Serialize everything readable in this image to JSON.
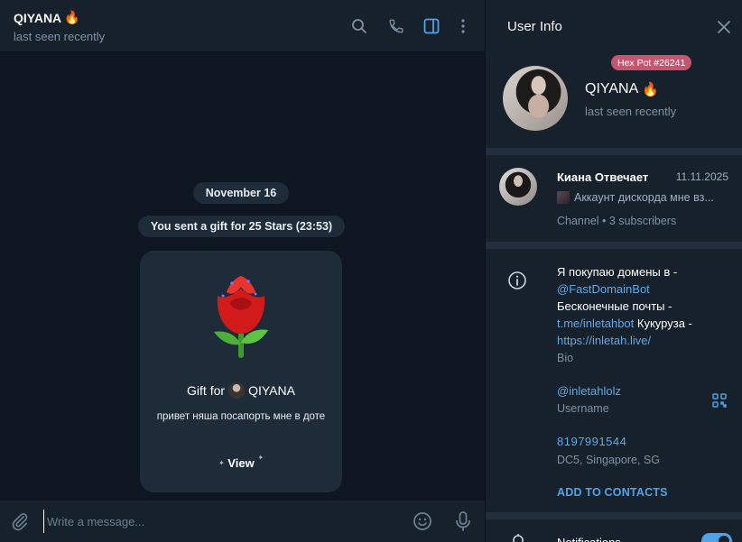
{
  "chat": {
    "title": "QIYANA",
    "title_emoji": "🔥",
    "status": "last seen recently",
    "icons": [
      "search-icon",
      "phone-icon",
      "sidebar-toggle-icon",
      "more-icon"
    ],
    "date_pill": "November 16",
    "service_message": "You sent a gift for 25 Stars (23:53)",
    "gift": {
      "emoji": "🌹",
      "title_prefix": "Gift for",
      "recipient": "QIYANA",
      "message": "привет няша посапорть мне в доте",
      "view_label": "View"
    },
    "composer": {
      "placeholder": "Write a message...",
      "icons": [
        "attach-icon",
        "emoji-icon",
        "microphone-icon"
      ]
    }
  },
  "user_info": {
    "title": "User Info",
    "badge": "Hex Pot #26241",
    "name": "QIYANA",
    "name_emoji": "🔥",
    "status": "last seen recently",
    "channel": {
      "name": "Киана Отвечает",
      "date": "11.11.2025",
      "last_message": "Аккаунт дискорда мне вз...",
      "subscribers": "Channel • 3 subscribers"
    },
    "bio": {
      "line1": "Я покупаю домены в -",
      "link1": "@FastDomainBot",
      "line2": "Бесконечные почты -",
      "link2": "t.me/inletahbot",
      "line3_suffix": " Кукуруза -",
      "link3": "https://inletah.live/",
      "label": "Bio"
    },
    "username": {
      "value": "@inletahlolz",
      "label": "Username"
    },
    "phone": {
      "value": "8197991544",
      "location": "DC5, Singapore, SG"
    },
    "add_contacts": "ADD TO CONTACTS",
    "notifications": {
      "label": "Notifications",
      "enabled": true
    }
  },
  "colors": {
    "accent": "#4fa3e6",
    "badge": "#c6566f",
    "panel": "#17212b",
    "chat_bg": "#0e1621",
    "bubble": "#1e2c3a"
  }
}
